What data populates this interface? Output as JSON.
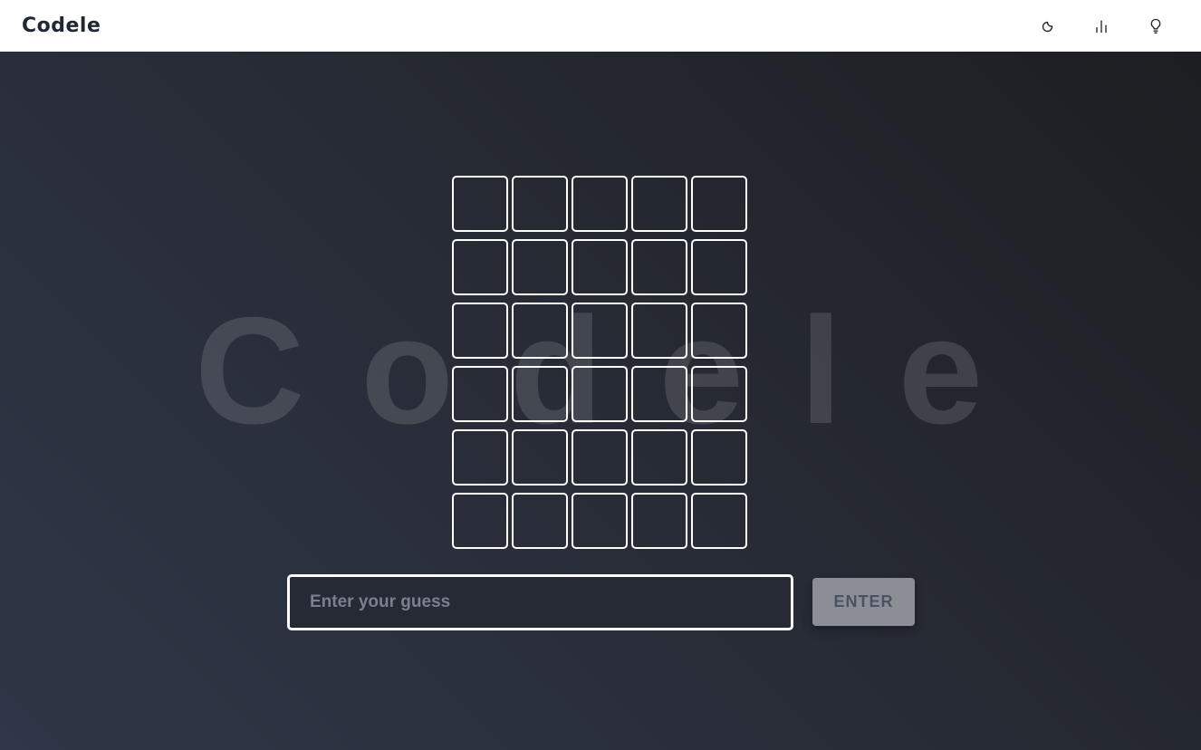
{
  "app": {
    "title": "Codele"
  },
  "header": {
    "icons": [
      {
        "name": "moon-icon",
        "action": "toggle-theme"
      },
      {
        "name": "bar-chart-icon",
        "action": "statistics"
      },
      {
        "name": "lightbulb-icon",
        "action": "hint"
      }
    ]
  },
  "watermark": {
    "text": "Codele"
  },
  "board": {
    "rows": [
      [
        "",
        "",
        "",
        "",
        ""
      ],
      [
        "",
        "",
        "",
        "",
        ""
      ],
      [
        "",
        "",
        "",
        "",
        ""
      ],
      [
        "",
        "",
        "",
        "",
        ""
      ],
      [
        "",
        "",
        "",
        "",
        ""
      ],
      [
        "",
        "",
        "",
        "",
        ""
      ]
    ]
  },
  "guess": {
    "placeholder": "Enter your guess",
    "value": ""
  },
  "enter_button": {
    "label": "ENTER"
  },
  "colors": {
    "header_bg": "#ffffff",
    "title": "#1f2733",
    "main_bg_dark": "#1d1e22",
    "main_bg_light": "#2f3748",
    "tile_border": "#ffffff",
    "button_bg": "#8b8f95",
    "button_text": "#4a5263"
  }
}
